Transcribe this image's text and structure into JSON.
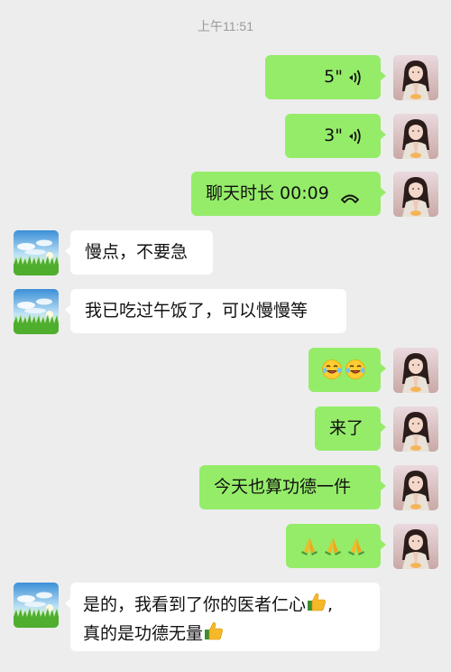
{
  "header": {
    "timestamp": "上午11:51"
  },
  "messages": {
    "m1": {
      "duration": "5\""
    },
    "m2": {
      "duration": "3\""
    },
    "m3": {
      "text": "聊天时长 00:09"
    },
    "m4": {
      "text": "慢点，不要急"
    },
    "m5": {
      "text": "我已吃过午饭了，可以慢慢等"
    },
    "m6": {
      "emoji": [
        "laughing-tears",
        "laughing-tears"
      ]
    },
    "m7": {
      "text": "来了"
    },
    "m8": {
      "text": "今天也算功德一件"
    },
    "m9": {
      "emoji": [
        "praying-hands",
        "praying-hands",
        "praying-hands"
      ]
    },
    "m10": {
      "line1": "是的，我看到了你的医者仁心",
      "line2": "真的是功德无量"
    }
  },
  "colors": {
    "background": "#ededed",
    "outgoing_bubble": "#95ec69",
    "incoming_bubble": "#ffffff"
  },
  "icons": {
    "voice": "voice-wave-icon",
    "call": "phone-hangup-icon",
    "thumbs_up": "thumbs-up-emoji"
  }
}
